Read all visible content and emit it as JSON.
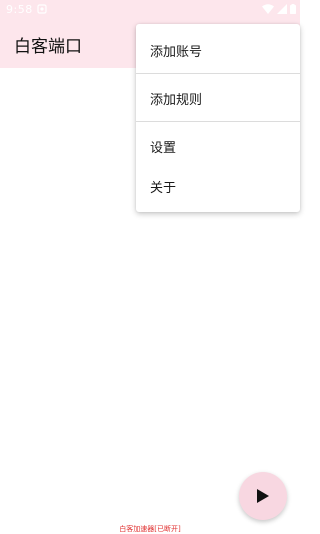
{
  "status_bar": {
    "time": "9:58"
  },
  "app_bar": {
    "title": "白客端口",
    "background": "#fde6ec"
  },
  "menu": {
    "items": [
      {
        "label": "添加账号"
      },
      {
        "label": "添加规则"
      },
      {
        "label": "设置"
      },
      {
        "label": "关于"
      }
    ]
  },
  "fab": {
    "icon": "play-icon",
    "background": "#f8d7e1"
  },
  "footer": {
    "status_text": "白客加速器[已断开]",
    "status_color": "#e03030"
  }
}
